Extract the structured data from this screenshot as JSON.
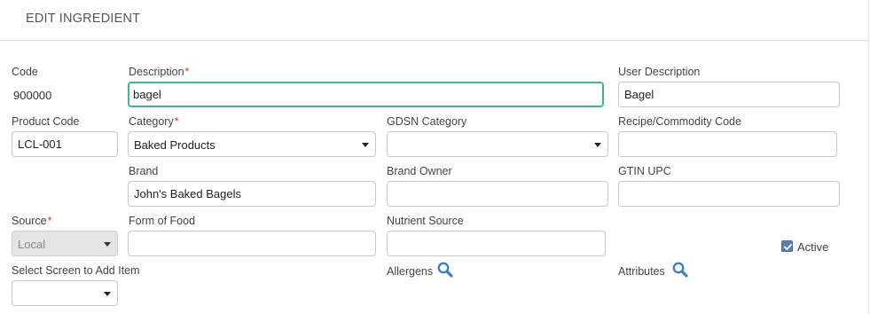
{
  "header": {
    "title": "EDIT INGREDIENT"
  },
  "code": {
    "label": "Code",
    "value": "900000"
  },
  "description": {
    "label": "Description",
    "required_mark": "*",
    "value": "bagel"
  },
  "user_description": {
    "label": "User Description",
    "value": "Bagel"
  },
  "product_code": {
    "label": "Product Code",
    "value": "LCL-001"
  },
  "category": {
    "label": "Category",
    "required_mark": "*",
    "selected": "Baked Products"
  },
  "gdsn_category": {
    "label": "GDSN Category",
    "selected": ""
  },
  "recipe_code": {
    "label": "Recipe/Commodity Code",
    "value": ""
  },
  "brand": {
    "label": "Brand",
    "value": "John's Baked Bagels"
  },
  "brand_owner": {
    "label": "Brand Owner",
    "value": ""
  },
  "gtin_upc": {
    "label": "GTIN UPC",
    "value": ""
  },
  "source": {
    "label": "Source",
    "required_mark": "*",
    "selected": "Local"
  },
  "form_of_food": {
    "label": "Form of Food",
    "value": ""
  },
  "nutrient_source": {
    "label": "Nutrient Source",
    "value": ""
  },
  "active": {
    "label": "Active",
    "checked": true
  },
  "select_screen": {
    "label": "Select Screen to Add Item",
    "selected": ""
  },
  "allergens": {
    "label": "Allergens",
    "icon": "search-icon"
  },
  "attributes": {
    "label": "Attributes",
    "icon": "search-icon"
  },
  "colors": {
    "focus_border": "#3fb58f",
    "required": "#d9302c",
    "icon_blue": "#3a7fc6",
    "checkbox": "#5a7fb3"
  }
}
